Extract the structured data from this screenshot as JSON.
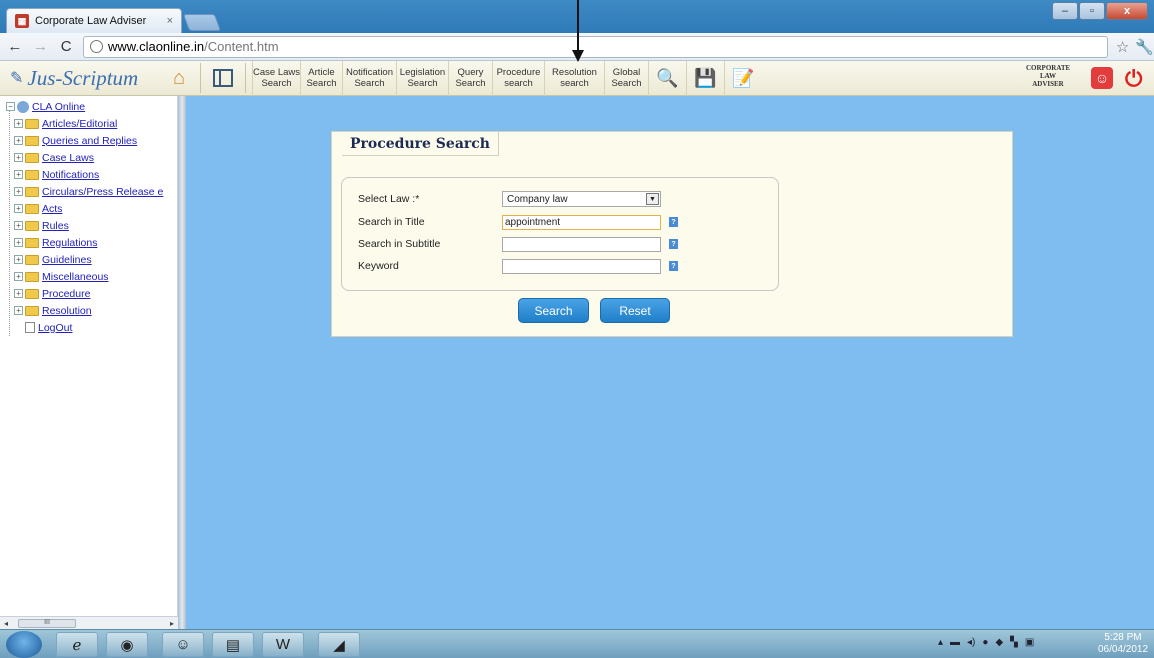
{
  "browser": {
    "tab_title": "Corporate Law Adviser",
    "tab_close": "×",
    "url_host": "www.claonline.in",
    "url_path": "/Content.htm",
    "window_controls": [
      "–",
      "▫",
      "x"
    ]
  },
  "app": {
    "brand": "Jus-Scriptum",
    "menu": [
      {
        "line1": "Case Laws",
        "line2": "Search"
      },
      {
        "line1": "Article",
        "line2": "Search"
      },
      {
        "line1": "Notification",
        "line2": "Search"
      },
      {
        "line1": "Legislation",
        "line2": "Search"
      },
      {
        "line1": "Query",
        "line2": "Search"
      },
      {
        "line1": "Procedure",
        "line2": "search"
      },
      {
        "line1": "Resolution",
        "line2": "search"
      },
      {
        "line1": "Global",
        "line2": "Search"
      }
    ],
    "logo_text": [
      "CORPORATE",
      "LAW",
      "ADVISER"
    ]
  },
  "tree": {
    "root": "CLA Online",
    "items": [
      "Articles/Editorial",
      "Queries and Replies",
      "Case Laws",
      "Notifications",
      "Circulars/Press Release e",
      "Acts",
      "Rules",
      "Regulations",
      "Guidelines",
      "Miscellaneous",
      "Procedure",
      "Resolution"
    ],
    "logout": "LogOut",
    "scroll_thumb": "III"
  },
  "form": {
    "title": "Procedure Search",
    "fields": {
      "law_label": "Select Law :*",
      "law_value": "Company law",
      "title_label": "Search in Title",
      "title_value": "appointment",
      "subtitle_label": "Search in Subtitle",
      "subtitle_value": "",
      "keyword_label": "Keyword",
      "keyword_value": ""
    },
    "search_button": "Search",
    "reset_button": "Reset"
  },
  "taskbar": {
    "time": "5:28 PM",
    "date": "06/04/2012"
  }
}
